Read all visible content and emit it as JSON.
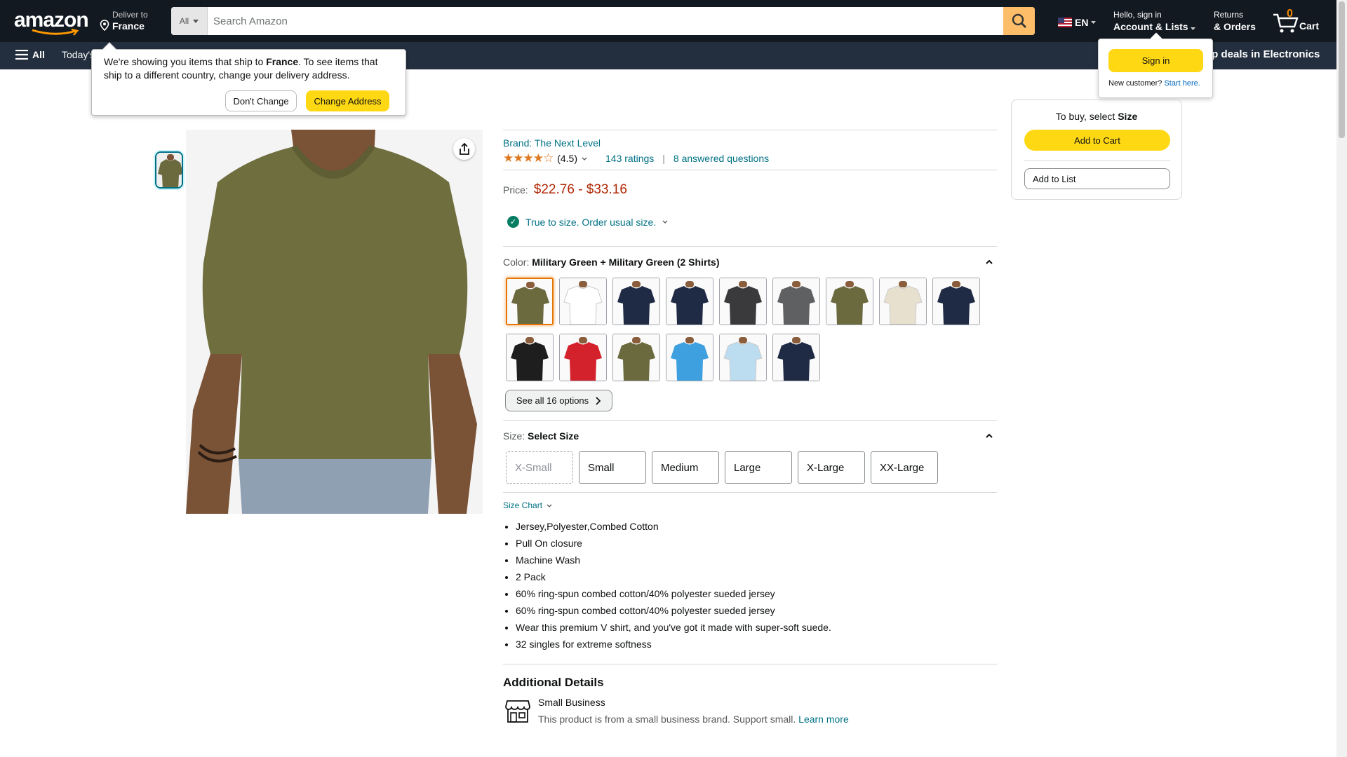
{
  "header": {
    "logo": "amazon",
    "deliver_line1": "Deliver to",
    "deliver_line2": "France",
    "search_category": "All",
    "search_placeholder": "Search Amazon",
    "language": "EN",
    "account_line1": "Hello, sign in",
    "account_line2": "Account & Lists",
    "returns_line1": "Returns",
    "returns_line2": "& Orders",
    "cart_count": "0",
    "cart_label": "Cart"
  },
  "subnav": {
    "all_label": "All",
    "todays_deals": "Today's",
    "promo": "op deals in Electronics"
  },
  "address_popover": {
    "text_pre": "We're showing you items that ship to ",
    "country": "France",
    "text_post": ". To see items that ship to a different country, change your delivery address.",
    "dont_change": "Don't Change",
    "change_address": "Change Address"
  },
  "signin_popover": {
    "button": "Sign in",
    "new_customer": "New customer?",
    "start_here": "Start here."
  },
  "product": {
    "brand": "Brand: The Next Level",
    "rating_value": "(4.5)",
    "ratings": "143 ratings",
    "separator": "|",
    "questions": "8 answered questions",
    "price_label": "Price:",
    "price_range": "$22.76 - $33.16",
    "fit": "True to size. Order usual size.",
    "color_label": "Color:",
    "color_value": "Military Green + Military Green (2 Shirts)",
    "see_all": "See all 16 options",
    "size_label": "Size:",
    "size_value": "Select Size",
    "sizes": [
      "X-Small",
      "Small",
      "Medium",
      "Large",
      "X-Large",
      "XX-Large"
    ],
    "size_chart": "Size Chart",
    "bullets": [
      "Jersey,Polyester,Combed Cotton",
      "Pull On closure",
      "Machine Wash",
      "2 Pack",
      "60% ring-spun combed cotton/40% polyester sueded jersey",
      "60% ring-spun combed cotton/40% polyester sueded jersey",
      "Wear this premium V shirt, and you've got it made with super-soft suede.",
      "32 singles for extreme softness"
    ],
    "additional_details": "Additional Details",
    "small_business": "Small Business",
    "small_business_desc": "This product is from a small business brand. Support small.",
    "learn_more": "Learn more"
  },
  "buybox": {
    "title_pre": "To buy, select ",
    "title_bold": "Size",
    "add_to_cart": "Add to Cart",
    "add_to_list": "Add to List"
  },
  "swatch_colors": [
    "#6b6a3f",
    "#ffffff",
    "#1f2a44",
    "#1f2a44",
    "#3a3a3c",
    "#5f6062",
    "#6b6a3f",
    "#e8e0cf",
    "#1f2a44",
    "#1e1e1e",
    "#d4222c",
    "#6b6a3f",
    "#3fa0e0",
    "#bcdcf0",
    "#1f2a44"
  ]
}
